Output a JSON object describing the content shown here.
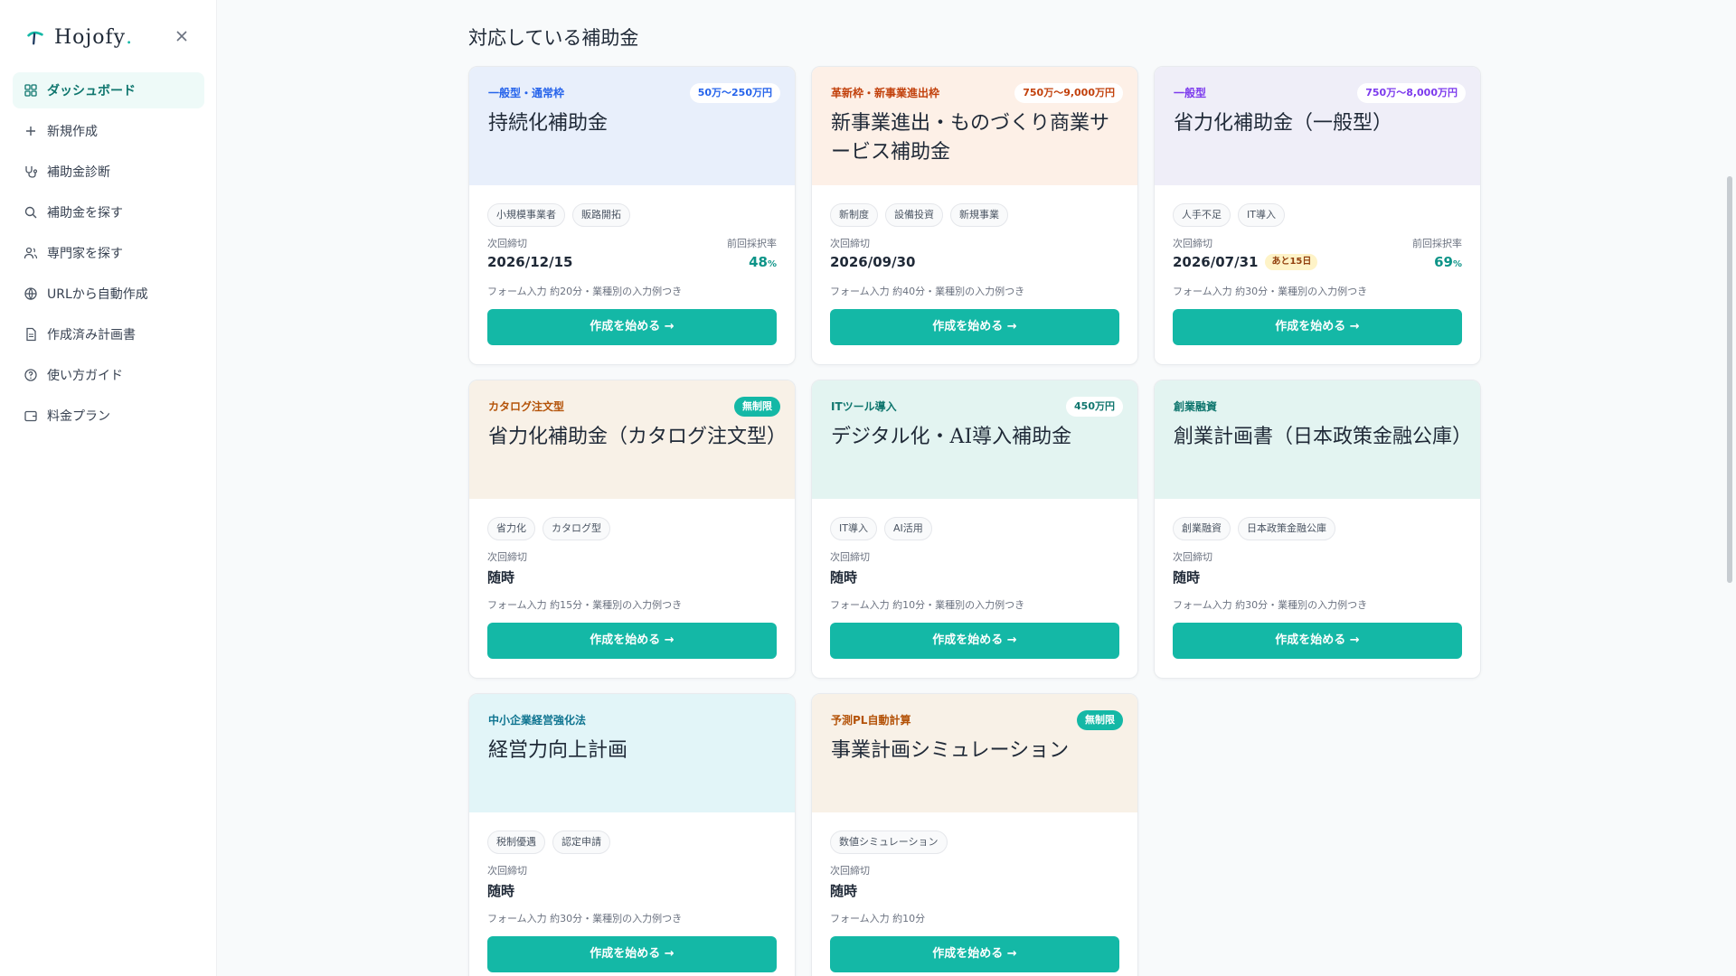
{
  "app": {
    "brand": "Hojofy",
    "brand_dot": ".",
    "accent": "#14b8a6"
  },
  "sidebar": {
    "items": [
      {
        "label": "ダッシュボード",
        "icon": "dashboard-icon",
        "active": true
      },
      {
        "label": "新規作成",
        "icon": "plus-icon"
      },
      {
        "label": "補助金診断",
        "icon": "stethoscope-icon"
      },
      {
        "label": "補助金を探す",
        "icon": "search-icon"
      },
      {
        "label": "専門家を探す",
        "icon": "users-icon"
      },
      {
        "label": "URLから自動作成",
        "icon": "globe-icon"
      },
      {
        "label": "作成済み計画書",
        "icon": "document-icon"
      },
      {
        "label": "使い方ガイド",
        "icon": "help-icon"
      },
      {
        "label": "料金プラン",
        "icon": "wallet-icon"
      }
    ]
  },
  "main": {
    "title": "対応している補助金",
    "deadline_label": "次回締切",
    "rate_label": "前回採択率",
    "start_label": "作成を始める →",
    "cards": [
      {
        "category": "一般型・通常枠",
        "badge": "50万〜250万円",
        "title": "持続化補助金",
        "tags": [
          "小規模事業者",
          "販路開拓"
        ],
        "deadline": "2026/12/15",
        "soon": "",
        "rate": "48",
        "rate_unit": "%",
        "note": "フォーム入力 約20分・業種別の入力例つき",
        "head_color": "#e8effb",
        "cat_color": "#2563eb",
        "badge_color": "#2563eb",
        "badge_solid": false
      },
      {
        "category": "革新枠・新事業進出枠",
        "badge": "750万〜9,000万円",
        "title": "新事業進出・ものづくり商業サービス補助金",
        "tags": [
          "新制度",
          "設備投資",
          "新規事業"
        ],
        "deadline": "2026/09/30",
        "soon": "",
        "rate": "",
        "rate_unit": "",
        "note": "フォーム入力 約40分・業種別の入力例つき",
        "head_color": "#fdf0e7",
        "cat_color": "#c2410c",
        "badge_color": "#c2410c",
        "badge_solid": false
      },
      {
        "category": "一般型",
        "badge": "750万〜8,000万円",
        "title": "省力化補助金（一般型）",
        "tags": [
          "人手不足",
          "IT導入"
        ],
        "deadline": "2026/07/31",
        "soon": "あと15日",
        "rate": "69",
        "rate_unit": "%",
        "note": "フォーム入力 約30分・業種別の入力例つき",
        "head_color": "#efeef8",
        "cat_color": "#7c3aed",
        "badge_color": "#7c3aed",
        "badge_solid": false
      },
      {
        "category": "カタログ注文型",
        "badge": "無制限",
        "title": "省力化補助金（カタログ注文型）",
        "tags": [
          "省力化",
          "カタログ型"
        ],
        "deadline": "随時",
        "soon": "",
        "rate": "",
        "rate_unit": "",
        "note": "フォーム入力 約15分・業種別の入力例つき",
        "head_color": "#f8f1e7",
        "cat_color": "#b45309",
        "badge_color": "#ffffff",
        "badge_solid": true
      },
      {
        "category": "ITツール導入",
        "badge": "450万円",
        "title": "デジタル化・AI導入補助金",
        "tags": [
          "IT導入",
          "AI活用"
        ],
        "deadline": "随時",
        "soon": "",
        "rate": "",
        "rate_unit": "",
        "note": "フォーム入力 約10分・業種別の入力例つき",
        "head_color": "#e3f4f1",
        "cat_color": "#0f766e",
        "badge_color": "#0f766e",
        "badge_solid": false
      },
      {
        "category": "創業融資",
        "badge": "",
        "title": "創業計画書（日本政策金融公庫）",
        "tags": [
          "創業融資",
          "日本政策金融公庫"
        ],
        "deadline": "随時",
        "soon": "",
        "rate": "",
        "rate_unit": "",
        "note": "フォーム入力 約30分・業種別の入力例つき",
        "head_color": "#e3f4f1",
        "cat_color": "#0f766e",
        "badge_color": "#0f766e",
        "badge_solid": false
      },
      {
        "category": "中小企業経営強化法",
        "badge": "",
        "title": "経営力向上計画",
        "tags": [
          "税制優遇",
          "認定申請"
        ],
        "deadline": "随時",
        "soon": "",
        "rate": "",
        "rate_unit": "",
        "note": "フォーム入力 約30分・業種別の入力例つき",
        "head_color": "#e2f5f8",
        "cat_color": "#0e7490",
        "badge_color": "#0e7490",
        "badge_solid": false
      },
      {
        "category": "予測PL自動計算",
        "badge": "無制限",
        "title": "事業計画シミュレーション",
        "tags": [
          "数値シミュレーション"
        ],
        "deadline": "随時",
        "soon": "",
        "rate": "",
        "rate_unit": "",
        "note": "フォーム入力 約10分",
        "head_color": "#f8f1e7",
        "cat_color": "#b45309",
        "badge_color": "#ffffff",
        "badge_solid": true
      }
    ]
  }
}
